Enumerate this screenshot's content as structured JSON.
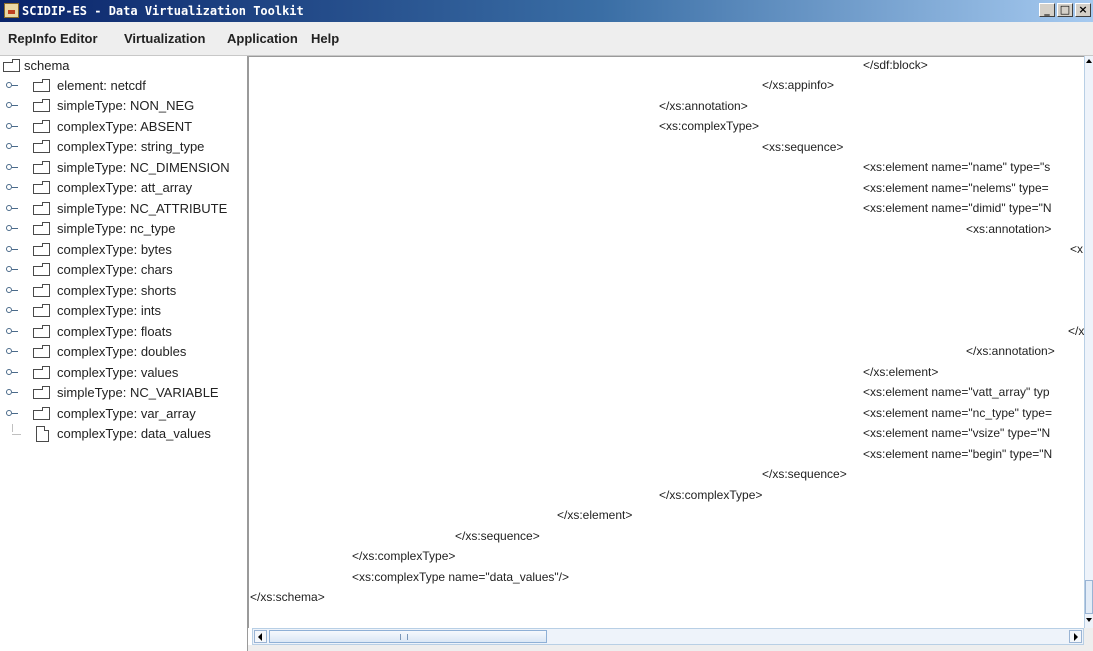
{
  "window": {
    "title": "SCIDIP-ES - Data Virtualization Toolkit",
    "buttons": {
      "minimize": "_",
      "maximize": "□",
      "close": "×"
    }
  },
  "menubar": {
    "items": [
      "RepInfo Editor",
      "Virtualization",
      "Application",
      "Help"
    ]
  },
  "tree": {
    "root": "schema",
    "items": [
      "element: netcdf",
      "simpleType: NON_NEG",
      "complexType: ABSENT",
      "complexType: string_type",
      "simpleType: NC_DIMENSION",
      "complexType: att_array",
      "simpleType: NC_ATTRIBUTE",
      "simpleType: nc_type",
      "complexType: bytes",
      "complexType: chars",
      "complexType: shorts",
      "complexType: ints",
      "complexType: floats",
      "complexType: doubles",
      "complexType: values",
      "simpleType: NC_VARIABLE",
      "complexType: var_array",
      "complexType: data_values"
    ]
  },
  "xml_lines": [
    "</sdf:block>",
    "</xs:appinfo>",
    "</xs:annotation>",
    "<xs:complexType>",
    "<xs:sequence>",
    "<xs:element name=\"name\" type=\"s",
    "<xs:element name=\"nelems\" type=",
    "<xs:element name=\"dimid\" type=\"N",
    "<xs:annotation>",
    "<x",
    "</x",
    "</xs:annotation>",
    "</xs:element>",
    "<xs:element name=\"vatt_array\" typ",
    "<xs:element name=\"nc_type\" type=",
    "<xs:element name=\"vsize\" type=\"N",
    "<xs:element name=\"begin\" type=\"N",
    "</xs:sequence>",
    "</xs:complexType>",
    "</xs:element>",
    "</xs:sequence>",
    "</xs:complexType>",
    "<xs:complexType name=\"data_values\"/>",
    "</xs:schema>"
  ]
}
